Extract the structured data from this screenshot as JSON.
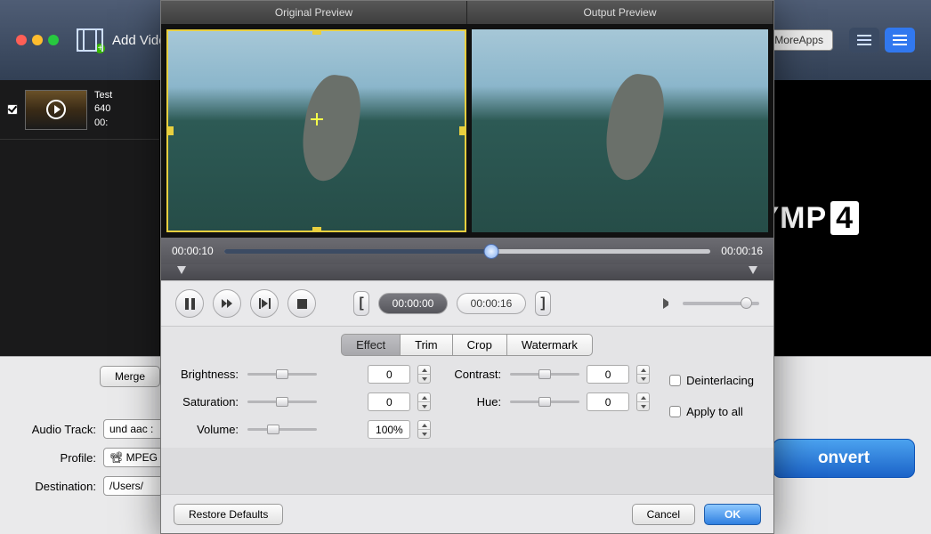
{
  "toolbar": {
    "add_video": "Add Video",
    "more_apps": "MoreApps"
  },
  "list": {
    "checked": true,
    "title": "Test",
    "res": "640",
    "dur": "00:"
  },
  "brand": {
    "text": "NYMP",
    "suffix": "4"
  },
  "pv_bar": {
    "time": "00:00:16"
  },
  "bottom": {
    "merge": "Merge",
    "rows": {
      "audio_label": "Audio Track:",
      "audio_value": "und aac :",
      "profile_label": "Profile:",
      "profile_value": "MPEG",
      "dest_label": "Destination:",
      "dest_value": "/Users/"
    },
    "convert": "onvert"
  },
  "editor": {
    "tabs": {
      "orig": "Original Preview",
      "out": "Output Preview"
    },
    "time": {
      "current": "00:00:10",
      "total": "00:00:16"
    },
    "cut": {
      "start": "00:00:00",
      "end": "00:00:16"
    },
    "tabs2": [
      "Effect",
      "Trim",
      "Crop",
      "Watermark"
    ],
    "active_tab": "Effect",
    "fx": {
      "brightness": {
        "label": "Brightness:",
        "value": "0"
      },
      "contrast": {
        "label": "Contrast:",
        "value": "0"
      },
      "saturation": {
        "label": "Saturation:",
        "value": "0"
      },
      "hue": {
        "label": "Hue:",
        "value": "0"
      },
      "volume": {
        "label": "Volume:",
        "value": "100%"
      }
    },
    "checks": {
      "deinterlacing": "Deinterlacing",
      "apply": "Apply to all"
    },
    "footer": {
      "restore": "Restore Defaults",
      "cancel": "Cancel",
      "ok": "OK"
    }
  }
}
